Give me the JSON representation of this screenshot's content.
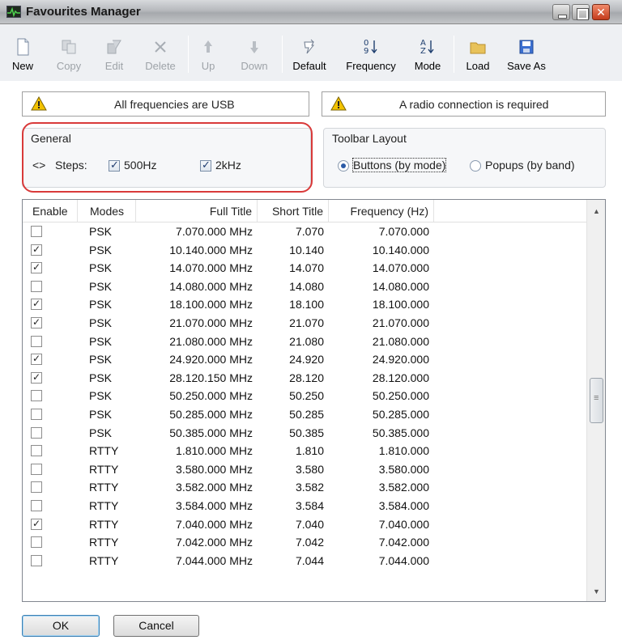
{
  "window": {
    "title": "Favourites Manager",
    "close_glyph": "✕"
  },
  "toolbar": {
    "buttons": [
      {
        "label": "New",
        "icon": "new-icon",
        "enabled": true
      },
      {
        "label": "Copy",
        "icon": "copy-icon",
        "enabled": false
      },
      {
        "label": "Edit",
        "icon": "edit-icon",
        "enabled": false
      },
      {
        "label": "Delete",
        "icon": "delete-icon",
        "enabled": false
      },
      {
        "label": "Up",
        "icon": "up-arrow-icon",
        "enabled": false
      },
      {
        "label": "Down",
        "icon": "down-arrow-icon",
        "enabled": false
      },
      {
        "label": "Default",
        "icon": "default-icon",
        "enabled": true
      },
      {
        "label": "Frequency",
        "icon": "sort-frequency-icon",
        "enabled": true
      },
      {
        "label": "Mode",
        "icon": "sort-mode-icon",
        "enabled": true
      },
      {
        "label": "Load",
        "icon": "folder-icon",
        "enabled": true
      },
      {
        "label": "Save As",
        "icon": "save-icon",
        "enabled": true
      }
    ],
    "sort_glyph_top": "0",
    "sort_glyph_mid": "9",
    "mode_glyph_top": "A",
    "mode_glyph_mid": "Z"
  },
  "info": {
    "left": "All frequencies are USB",
    "right": "A radio connection is required"
  },
  "general": {
    "title": "General",
    "steps_prefix": "<>",
    "steps_label": "Steps:",
    "step_500": {
      "label": "500Hz",
      "checked": true
    },
    "step_2k": {
      "label": "2kHz",
      "checked": true
    }
  },
  "toolbar_layout": {
    "title": "Toolbar Layout",
    "option_buttons": {
      "label": "Buttons (by mode)",
      "selected": true
    },
    "option_popups": {
      "label": "Popups (by band)",
      "selected": false
    }
  },
  "table": {
    "columns": [
      "Enable",
      "Modes",
      "Full Title",
      "Short Title",
      "Frequency (Hz)"
    ],
    "rows": [
      {
        "enabled": false,
        "mode": "PSK",
        "full": "7.070.000 MHz",
        "short": "7.070",
        "freq": "7.070.000"
      },
      {
        "enabled": true,
        "mode": "PSK",
        "full": "10.140.000 MHz",
        "short": "10.140",
        "freq": "10.140.000"
      },
      {
        "enabled": true,
        "mode": "PSK",
        "full": "14.070.000 MHz",
        "short": "14.070",
        "freq": "14.070.000"
      },
      {
        "enabled": false,
        "mode": "PSK",
        "full": "14.080.000 MHz",
        "short": "14.080",
        "freq": "14.080.000"
      },
      {
        "enabled": true,
        "mode": "PSK",
        "full": "18.100.000 MHz",
        "short": "18.100",
        "freq": "18.100.000"
      },
      {
        "enabled": true,
        "mode": "PSK",
        "full": "21.070.000 MHz",
        "short": "21.070",
        "freq": "21.070.000"
      },
      {
        "enabled": false,
        "mode": "PSK",
        "full": "21.080.000 MHz",
        "short": "21.080",
        "freq": "21.080.000"
      },
      {
        "enabled": true,
        "mode": "PSK",
        "full": "24.920.000 MHz",
        "short": "24.920",
        "freq": "24.920.000"
      },
      {
        "enabled": true,
        "mode": "PSK",
        "full": "28.120.150 MHz",
        "short": "28.120",
        "freq": "28.120.000"
      },
      {
        "enabled": false,
        "mode": "PSK",
        "full": "50.250.000 MHz",
        "short": "50.250",
        "freq": "50.250.000"
      },
      {
        "enabled": false,
        "mode": "PSK",
        "full": "50.285.000 MHz",
        "short": "50.285",
        "freq": "50.285.000"
      },
      {
        "enabled": false,
        "mode": "PSK",
        "full": "50.385.000 MHz",
        "short": "50.385",
        "freq": "50.385.000"
      },
      {
        "enabled": false,
        "mode": "RTTY",
        "full": "1.810.000 MHz",
        "short": "1.810",
        "freq": "1.810.000"
      },
      {
        "enabled": false,
        "mode": "RTTY",
        "full": "3.580.000 MHz",
        "short": "3.580",
        "freq": "3.580.000"
      },
      {
        "enabled": false,
        "mode": "RTTY",
        "full": "3.582.000 MHz",
        "short": "3.582",
        "freq": "3.582.000"
      },
      {
        "enabled": false,
        "mode": "RTTY",
        "full": "3.584.000 MHz",
        "short": "3.584",
        "freq": "3.584.000"
      },
      {
        "enabled": true,
        "mode": "RTTY",
        "full": "7.040.000 MHz",
        "short": "7.040",
        "freq": "7.040.000"
      },
      {
        "enabled": false,
        "mode": "RTTY",
        "full": "7.042.000 MHz",
        "short": "7.042",
        "freq": "7.042.000"
      },
      {
        "enabled": false,
        "mode": "RTTY",
        "full": "7.044.000 MHz",
        "short": "7.044",
        "freq": "7.044.000"
      }
    ],
    "scroll_up_glyph": "▲",
    "scroll_down_glyph": "▼"
  },
  "buttons": {
    "ok": "OK",
    "cancel": "Cancel"
  },
  "colors": {
    "highlight": "#d93a3a",
    "warning": "#f2c200",
    "save_icon": "#3b6fd0",
    "folder": "#e8c25a"
  }
}
